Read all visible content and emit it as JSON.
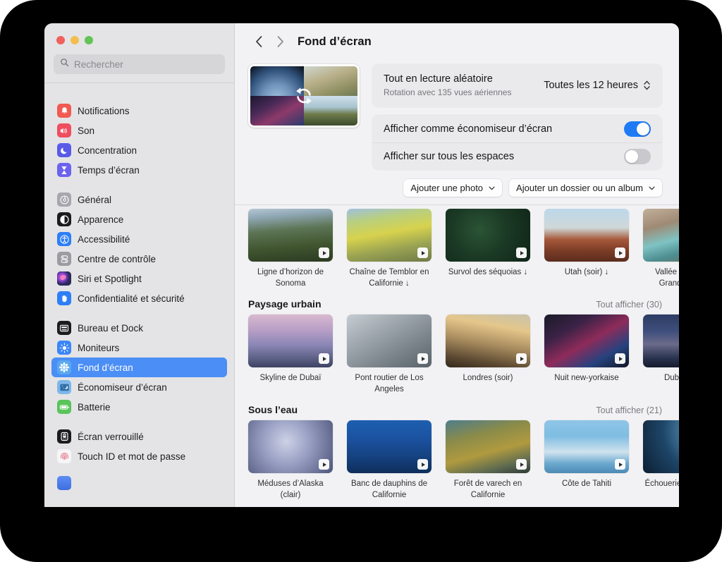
{
  "window": {
    "title": "Fond d’écran",
    "traffic_lights": [
      "close",
      "minimize",
      "zoom"
    ],
    "accent_color": "#1e7bf5",
    "selected_nav_color": "#4b8ef5"
  },
  "search": {
    "placeholder": "Rechercher",
    "value": ""
  },
  "sidebar": {
    "groups": [
      {
        "items": [
          {
            "label": "Notifications",
            "icon": "bell-icon",
            "color": "#f05a52",
            "selected": false
          },
          {
            "label": "Son",
            "icon": "speaker-icon",
            "color": "#ef4e5e",
            "selected": false
          },
          {
            "label": "Concentration",
            "icon": "moon-icon",
            "color": "#5a5ae8",
            "selected": false
          },
          {
            "label": "Temps d’écran",
            "icon": "hourglass-icon",
            "color": "#6b63ee",
            "selected": false
          }
        ]
      },
      {
        "items": [
          {
            "label": "Général",
            "icon": "gear-icon",
            "color": "#a7a7ad",
            "selected": false
          },
          {
            "label": "Apparence",
            "icon": "contrast-icon",
            "color": "#1c1c1e",
            "selected": false
          },
          {
            "label": "Accessibilité",
            "icon": "accessibility-icon",
            "color": "#2d7ef7",
            "selected": false
          },
          {
            "label": "Centre de contrôle",
            "icon": "control-center-icon",
            "color": "#9b9ba1",
            "selected": false
          },
          {
            "label": "Siri et Spotlight",
            "icon": "siri-icon",
            "color": "#1f1f33",
            "selected": false
          },
          {
            "label": "Confidentialité et sécurité",
            "icon": "hand-icon",
            "color": "#2d7ef7",
            "selected": false
          }
        ]
      },
      {
        "items": [
          {
            "label": "Bureau et Dock",
            "icon": "desktop-dock-icon",
            "color": "#1c1c1e",
            "selected": false
          },
          {
            "label": "Moniteurs",
            "icon": "brightness-icon",
            "color": "#3b86f7",
            "selected": false
          },
          {
            "label": "Fond d’écran",
            "icon": "wallpaper-icon",
            "color": "#5aa8ef",
            "selected": true
          },
          {
            "label": "Économiseur d’écran",
            "icon": "screensaver-icon",
            "color": "#7fb6e8",
            "selected": false
          },
          {
            "label": "Batterie",
            "icon": "battery-icon",
            "color": "#5ac45a",
            "selected": false
          }
        ]
      },
      {
        "items": [
          {
            "label": "Écran verrouillé",
            "icon": "lock-screen-icon",
            "color": "#1c1c1e",
            "selected": false
          },
          {
            "label": "Touch ID et mot de passe",
            "icon": "fingerprint-icon",
            "color": "#f6f6f7",
            "selected": false
          }
        ]
      }
    ]
  },
  "toolbar": {
    "back_icon": "chevron-left-icon",
    "forward_icon": "chevron-right-icon"
  },
  "preview": {
    "name": "wallpaper-rotation-preview",
    "rotation_icon": "rotate-arrows-icon"
  },
  "shuffle": {
    "title": "Tout en lecture aléatoire",
    "subtitle": "Rotation avec 135 vues aériennes",
    "interval_value": "Toutes les 12 heures",
    "stepper_icon": "chevron-up-down-icon"
  },
  "toggles": [
    {
      "label": "Afficher comme économiseur d’écran",
      "on": true
    },
    {
      "label": "Afficher sur tous les espaces",
      "on": false
    }
  ],
  "buttons": [
    {
      "label": "Ajouter une photo",
      "caret_icon": "chevron-down-icon"
    },
    {
      "label": "Ajouter un dossier ou un album",
      "caret_icon": "chevron-down-icon"
    }
  ],
  "gallery": {
    "sections": [
      {
        "title": "",
        "show_all": "",
        "has_header": false,
        "tiles": [
          {
            "caption": "Ligne d’horizon de Sonoma",
            "art": "g-sonoma",
            "badge": "play-icon"
          },
          {
            "caption": "Chaîne de Temblor en Californie ↓",
            "art": "g-temblor",
            "badge": "play-icon"
          },
          {
            "caption": "Survol des séquoias ↓",
            "art": "g-sequoia",
            "badge": "play-icon"
          },
          {
            "caption": "Utah (soir) ↓",
            "art": "g-utah",
            "badge": "play-icon"
          },
          {
            "caption": "Vallée fluviale du Grand Canyon",
            "art": "g-canyon",
            "badge": "play-icon"
          }
        ]
      },
      {
        "title": "Paysage urbain",
        "show_all": "Tout afficher (30)",
        "has_header": true,
        "tiles": [
          {
            "caption": "Skyline de Dubaï",
            "art": "g-dubai",
            "badge": "play-icon"
          },
          {
            "caption": "Pont routier de Los Angeles",
            "art": "g-la",
            "badge": "play-icon"
          },
          {
            "caption": "Londres (soir)",
            "art": "g-londres",
            "badge": "play-icon"
          },
          {
            "caption": "Nuit new-yorkaise",
            "art": "g-nyc",
            "badge": "play-icon"
          },
          {
            "caption": "Dubaï (nuit)",
            "art": "g-dubain",
            "badge": "play-icon"
          }
        ]
      },
      {
        "title": "Sous l’eau",
        "show_all": "Tout afficher (21)",
        "has_header": true,
        "tiles": [
          {
            "caption": "Méduses d’Alaska (clair)",
            "art": "g-meduses",
            "badge": "play-icon"
          },
          {
            "caption": "Banc de dauphins de Californie",
            "art": "g-dauphins",
            "badge": "play-icon"
          },
          {
            "caption": "Forêt de varech en Californie",
            "art": "g-varech",
            "badge": "play-icon"
          },
          {
            "caption": "Côte de Tahiti",
            "art": "g-tahiti",
            "badge": "play-icon"
          },
          {
            "caption": "Échouerie de phoques",
            "art": "g-phoques",
            "badge": "play-icon"
          }
        ]
      }
    ]
  }
}
